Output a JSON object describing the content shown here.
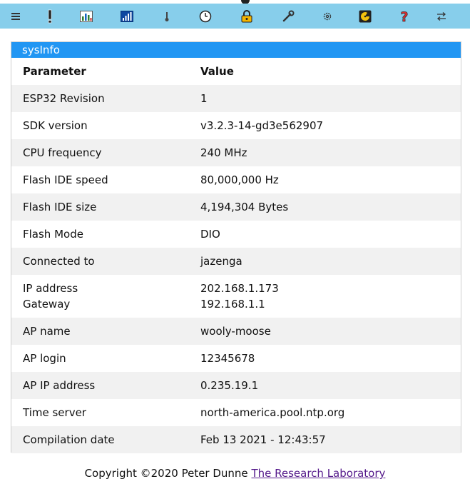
{
  "toolbar": {
    "icons": [
      {
        "name": "menu-icon",
        "glyph": "☰"
      },
      {
        "name": "alert-icon",
        "glyph": "!"
      },
      {
        "name": "bar-chart-icon",
        "glyph": "bars"
      },
      {
        "name": "signal-strength-icon",
        "glyph": "signal"
      },
      {
        "name": "thermometer-icon",
        "glyph": "thermo"
      },
      {
        "name": "clock-icon",
        "glyph": "clock"
      },
      {
        "name": "lock-icon",
        "glyph": "lock"
      },
      {
        "name": "wrench-icon",
        "glyph": "wrench"
      },
      {
        "name": "gear-icon",
        "glyph": "⚙"
      },
      {
        "name": "disk-icon",
        "glyph": "disk"
      },
      {
        "name": "help-icon",
        "glyph": "?"
      },
      {
        "name": "swap-arrows-icon",
        "glyph": "⇆"
      }
    ],
    "background": "#87ceeb"
  },
  "panel": {
    "title": "sysInfo",
    "header_color": "#2196f3",
    "columns": [
      "Parameter",
      "Value"
    ],
    "rows": [
      {
        "param": "ESP32 Revision",
        "value": "1"
      },
      {
        "param": "SDK version",
        "value": "v3.2.3-14-gd3e562907"
      },
      {
        "param": "CPU frequency",
        "value": "240 MHz"
      },
      {
        "param": "Flash IDE speed",
        "value": "80,000,000 Hz"
      },
      {
        "param": "Flash IDE size",
        "value": "4,194,304 Bytes"
      },
      {
        "param": "Flash Mode",
        "value": "DIO"
      },
      {
        "param": "Connected to",
        "value": "jazenga"
      },
      {
        "param": "IP address",
        "value": "202.168.1.173",
        "param2": "Gateway",
        "value2": "192.168.1.1"
      },
      {
        "param": "AP name",
        "value": "wooly-moose"
      },
      {
        "param": "AP login",
        "value": "12345678"
      },
      {
        "param": "AP IP address",
        "value": "0.235.19.1"
      },
      {
        "param": "Time server",
        "value": "north-america.pool.ntp.org"
      },
      {
        "param": "Compilation date",
        "value": "Feb 13 2021 - 12:43:57"
      }
    ]
  },
  "footer": {
    "copyright": "Copyright ©2020 Peter Dunne",
    "link_text": "The Research Laboratory"
  }
}
